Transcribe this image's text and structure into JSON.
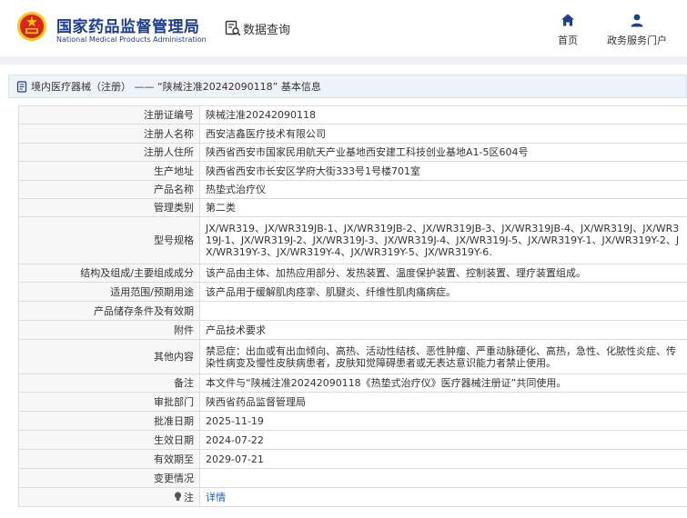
{
  "header": {
    "org_name_cn": "国家药品监督管理局",
    "org_name_en": "National Medical Products Administration",
    "data_query": "数据查询",
    "nav": {
      "home": "首页",
      "gov_portal": "政务服务门户"
    }
  },
  "breadcrumb": {
    "text": "境内医疗器械（注册） —— “陕械注准20242090118” 基本信息"
  },
  "detail": {
    "rows": [
      {
        "label": "注册证编号",
        "value": "陕械注准20242090118"
      },
      {
        "label": "注册人名称",
        "value": "西安洁鑫医疗技术有限公司"
      },
      {
        "label": "注册人住所",
        "value": "陕西省西安市国家民用航天产业基地西安建工科技创业基地A1-5区604号"
      },
      {
        "label": "生产地址",
        "value": "陕西省西安市长安区学府大街333号1号楼701室"
      },
      {
        "label": "产品名称",
        "value": "热垫式治疗仪"
      },
      {
        "label": "管理类别",
        "value": "第二类"
      },
      {
        "label": "型号规格",
        "value": "JX/WR319、JX/WR319JB-1、JX/WR319JB-2、JX/WR319JB-3、JX/WR319JB-4、JX/WR319J、JX/WR319J-1、JX/WR319J-2、JX/WR319J-3、JX/WR319J-4、JX/WR319J-5、JX/WR319Y-1、JX/WR319Y-2、JX/WR319Y-3、JX/WR319Y-4、JX/WR319Y-5、JX/WR319Y-6."
      },
      {
        "label": "结构及组成/主要组成成分",
        "value": "该产品由主体、加热应用部分、发热装置、温度保护装置、控制装置、理疗装置组成。"
      },
      {
        "label": "适用范围/预期用途",
        "value": "该产品用于缓解肌肉痉挛、肌腱炎、纤维性肌肉痛病症。"
      },
      {
        "label": "产品储存条件及有效期",
        "value": ""
      },
      {
        "label": "附件",
        "value": "产品技术要求"
      },
      {
        "label": "其他内容",
        "value": "禁忌症：出血或有出血倾向、高热、活动性结核、恶性肿瘤、严重动脉硬化、高热，急性、化脓性炎症、传染性病变及慢性皮肤病患者，皮肤知觉障碍患者或无表达意识能力者禁止使用。"
      },
      {
        "label": "备注",
        "value": "本文件与“陕械注准20242090118《热垫式治疗仪》医疗器械注册证”共同使用。"
      },
      {
        "label": "审批部门",
        "value": "陕西省药品监督管理局"
      },
      {
        "label": "批准日期",
        "value": "2025-11-19"
      },
      {
        "label": "生效日期",
        "value": "2024-07-22"
      },
      {
        "label": "有效期至",
        "value": "2029-07-21"
      },
      {
        "label": "变更情况",
        "value": ""
      }
    ],
    "note": {
      "label": "注",
      "link": "详情"
    }
  },
  "colors": {
    "brand_blue": "#1d3e8f",
    "emblem_red": "#d7261e",
    "emblem_gold": "#f5c518",
    "link_blue": "#1a5fb4",
    "label_bg": "#f7f7f7"
  },
  "icons": [
    "national-emblem-icon",
    "data-query-icon",
    "home-icon",
    "user-icon",
    "document-icon",
    "lightbulb-icon"
  ]
}
